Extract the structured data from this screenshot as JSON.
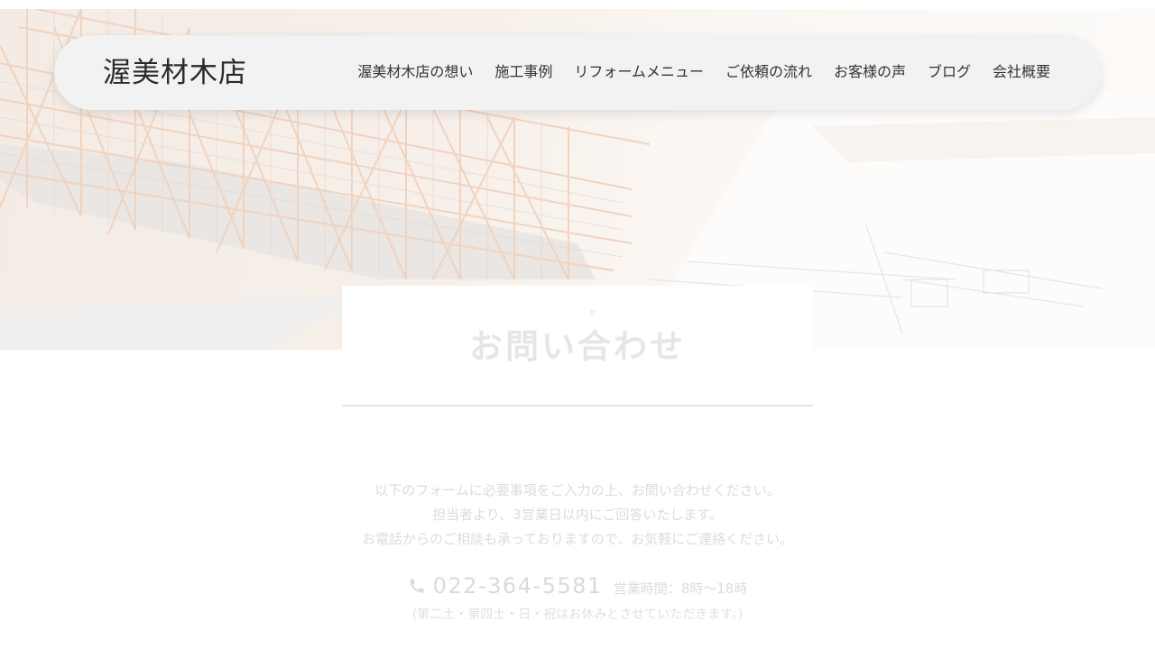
{
  "header": {
    "logo": "渥美材木店",
    "nav": [
      "渥美材木店の想い",
      "施工事例",
      "リフォームメニュー",
      "ご依頼の流れ",
      "お客様の声",
      "ブログ",
      "会社概要"
    ]
  },
  "hero": {
    "image": "architectural-wooden-frame-model-on-blueprints"
  },
  "page": {
    "title": "お問い合わせ"
  },
  "intro": {
    "line1": "以下のフォームに必要事項をご入力の上、お問い合わせください。",
    "line2": "担当者より、3営業日以内にご回答いたします。",
    "line3": "お電話からのご相談も承っておりますので、お気軽にご連絡ください。"
  },
  "contact": {
    "phone": "022-364-5581",
    "hours": "営業時間：8時〜18時",
    "closed_note": "(第二土・第四土・日・祝はお休みとさせていただきます。)",
    "icon": "phone-icon"
  },
  "colors": {
    "header_bg": "#f2f2f2",
    "title_underline": "#dbe8e6",
    "faded_text": "#dcdcdc"
  }
}
